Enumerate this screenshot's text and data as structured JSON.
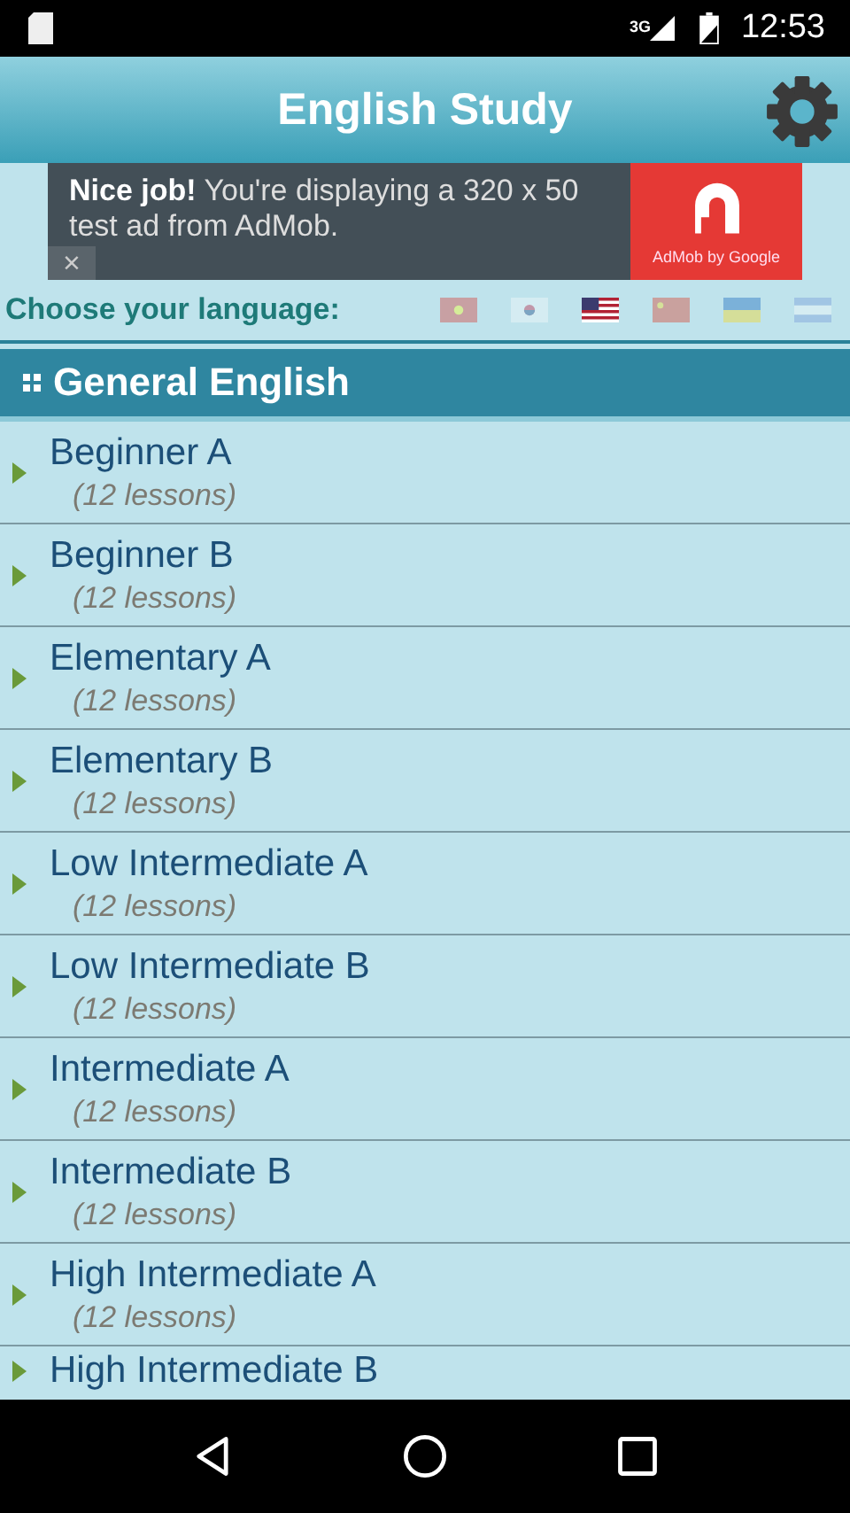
{
  "status_bar": {
    "network": "3G",
    "time": "12:53"
  },
  "app_bar": {
    "title": "English Study"
  },
  "ad": {
    "text": "**Nice job!** You're displaying a 320 x 50 test ad from AdMob.",
    "brand": "AdMob by Google",
    "close": "×"
  },
  "language": {
    "label": "Choose your language:",
    "flags": [
      {
        "kind": "vietnam",
        "selected": false
      },
      {
        "kind": "korea",
        "selected": false
      },
      {
        "kind": "usa",
        "selected": true
      },
      {
        "kind": "china",
        "selected": false
      },
      {
        "kind": "ukraine",
        "selected": false
      },
      {
        "kind": "striped",
        "selected": false
      }
    ]
  },
  "section": {
    "title": "General English"
  },
  "courses": [
    {
      "title": "Beginner A",
      "lessons": "(12 lessons)"
    },
    {
      "title": "Beginner B",
      "lessons": "(12 lessons)"
    },
    {
      "title": "Elementary A",
      "lessons": "(12 lessons)"
    },
    {
      "title": "Elementary B",
      "lessons": "(12 lessons)"
    },
    {
      "title": "Low Intermediate A",
      "lessons": "(12 lessons)"
    },
    {
      "title": "Low Intermediate B",
      "lessons": "(12 lessons)"
    },
    {
      "title": "Intermediate A",
      "lessons": "(12 lessons)"
    },
    {
      "title": "Intermediate B",
      "lessons": "(12 lessons)"
    },
    {
      "title": "High Intermediate A",
      "lessons": "(12 lessons)"
    },
    {
      "title": "High Intermediate B"
    }
  ]
}
